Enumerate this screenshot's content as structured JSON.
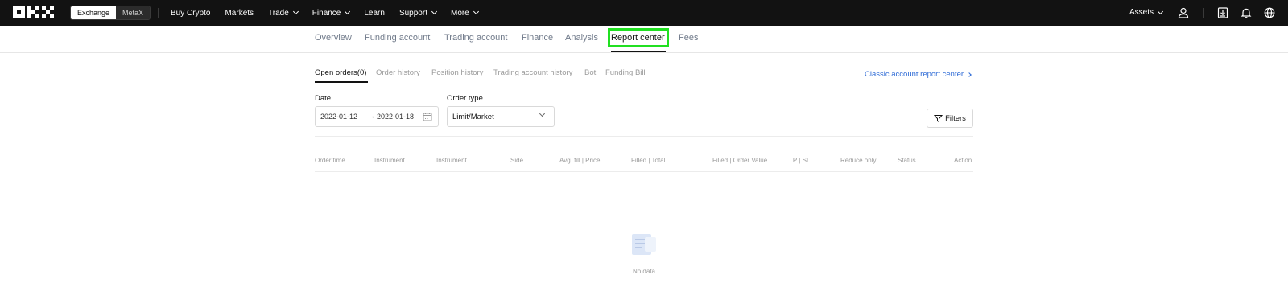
{
  "topnav": {
    "switch": {
      "exchange": "Exchange",
      "metax": "MetaX"
    },
    "links": [
      {
        "label": "Buy Crypto",
        "dropdown": false
      },
      {
        "label": "Markets",
        "dropdown": false
      },
      {
        "label": "Trade",
        "dropdown": true
      },
      {
        "label": "Finance",
        "dropdown": true
      },
      {
        "label": "Learn",
        "dropdown": false
      },
      {
        "label": "Support",
        "dropdown": true
      },
      {
        "label": "More",
        "dropdown": true
      }
    ],
    "assets": "Assets",
    "icons": [
      "user-icon",
      "download-icon",
      "bell-icon",
      "globe-icon"
    ]
  },
  "subtabs": [
    {
      "label": "Overview"
    },
    {
      "label": "Funding account"
    },
    {
      "label": "Trading account"
    },
    {
      "label": "Finance"
    },
    {
      "label": "Analysis"
    },
    {
      "label": "Report center",
      "active": true
    },
    {
      "label": "Fees"
    }
  ],
  "report_tabs": [
    {
      "label": "Open orders(0)",
      "active": true
    },
    {
      "label": "Order history"
    },
    {
      "label": "Position history"
    },
    {
      "label": "Trading account history"
    },
    {
      "label": "Bot"
    },
    {
      "label": "Funding Bill"
    }
  ],
  "classic_link": "Classic account report center",
  "filters": {
    "date_label": "Date",
    "date_from": "2022-01-12",
    "date_arrow": "→",
    "date_to": "2022-01-18",
    "order_type_label": "Order type",
    "order_type_value": "Limit/Market",
    "filters_button": "Filters"
  },
  "table": {
    "columns": [
      "Order time",
      "Instrument",
      "Instrument",
      "Side",
      "Avg. fill | Price",
      "Filled | Total",
      "Filled | Order Value",
      "TP | SL",
      "Reduce only",
      "Status",
      "Action"
    ]
  },
  "empty_text": "No data",
  "colors": {
    "topbar": "#121212",
    "highlight": "#21e021",
    "link": "#2e6bd6"
  }
}
